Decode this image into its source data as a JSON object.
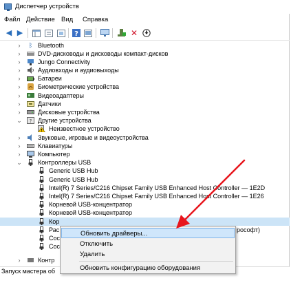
{
  "window": {
    "title": "Диспетчер устройств"
  },
  "menu": [
    "Файл",
    "Действие",
    "Вид",
    "Справка"
  ],
  "toolbar_icons": [
    "back-arrow-icon",
    "forward-arrow-icon",
    "show-hide-tree-icon",
    "properties-icon",
    "refresh-icon",
    "help-icon",
    "display-devices-icon",
    "update-driver-icon",
    "uninstall-device-icon",
    "download-driver-icon"
  ],
  "tree": {
    "items": [
      {
        "label": "Bluetooth",
        "icon": "bluetooth-icon"
      },
      {
        "label": "DVD-дисководы и дисководы компакт-дисков",
        "icon": "dvd-drive-icon"
      },
      {
        "label": "Jungo Connectivity",
        "icon": "usb-device-icon"
      },
      {
        "label": "Аудиовходы и аудиовыходы",
        "icon": "speaker-icon"
      },
      {
        "label": "Батареи",
        "icon": "battery-icon"
      },
      {
        "label": "Биометрические устройства",
        "icon": "fingerprint-icon"
      },
      {
        "label": "Видеоадаптеры",
        "icon": "display-adapter-icon"
      },
      {
        "label": "Датчики",
        "icon": "sensor-icon"
      },
      {
        "label": "Дисковые устройства",
        "icon": "disk-drive-icon"
      },
      {
        "label": "Другие устройства",
        "icon": "other-devices-icon"
      },
      {
        "label": "Неизвестное устройство",
        "icon": "unknown-device-warning-icon"
      },
      {
        "label": "Звуковые, игровые и видеоустройства",
        "icon": "sound-device-icon"
      },
      {
        "label": "Клавиатуры",
        "icon": "keyboard-icon"
      },
      {
        "label": "Компьютер",
        "icon": "computer-icon"
      },
      {
        "label": "Контроллеры USB",
        "icon": "usb-controller-icon"
      },
      {
        "label": "Generic USB Hub",
        "icon": "usb-plug-icon"
      },
      {
        "label": "Generic USB Hub",
        "icon": "usb-plug-icon"
      },
      {
        "label": "Intel(R) 7 Series/C216 Chipset Family USB Enhanced Host Controller — 1E2D",
        "icon": "usb-plug-icon"
      },
      {
        "label": "Intel(R) 7 Series/C216 Chipset Family USB Enhanced Host Controller — 1E26",
        "icon": "usb-plug-icon"
      },
      {
        "label": "Корневой USB-концентратор",
        "icon": "usb-plug-icon"
      },
      {
        "label": "Корневой USB-концентратор",
        "icon": "usb-plug-icon"
      },
      {
        "label": "Кор",
        "icon": "usb-plug-icon"
      },
      {
        "label": "Рас",
        "icon": "usb-plug-icon"
      },
      {
        "label": "Сос",
        "icon": "usb-plug-icon"
      },
      {
        "label": "Сос",
        "icon": "usb-plug-icon"
      },
      {
        "label": "Контр",
        "icon": "controller-icon"
      }
    ],
    "partial_right_text": "рософт)"
  },
  "context_menu": {
    "items": [
      "Обновить драйверы...",
      "Отключить",
      "Удалить",
      "Обновить конфигурацию оборудования"
    ]
  },
  "status": {
    "text": "Запуск мастера об"
  },
  "colors": {
    "arrow": "#e8161d",
    "highlight": "#cfe6fb"
  }
}
